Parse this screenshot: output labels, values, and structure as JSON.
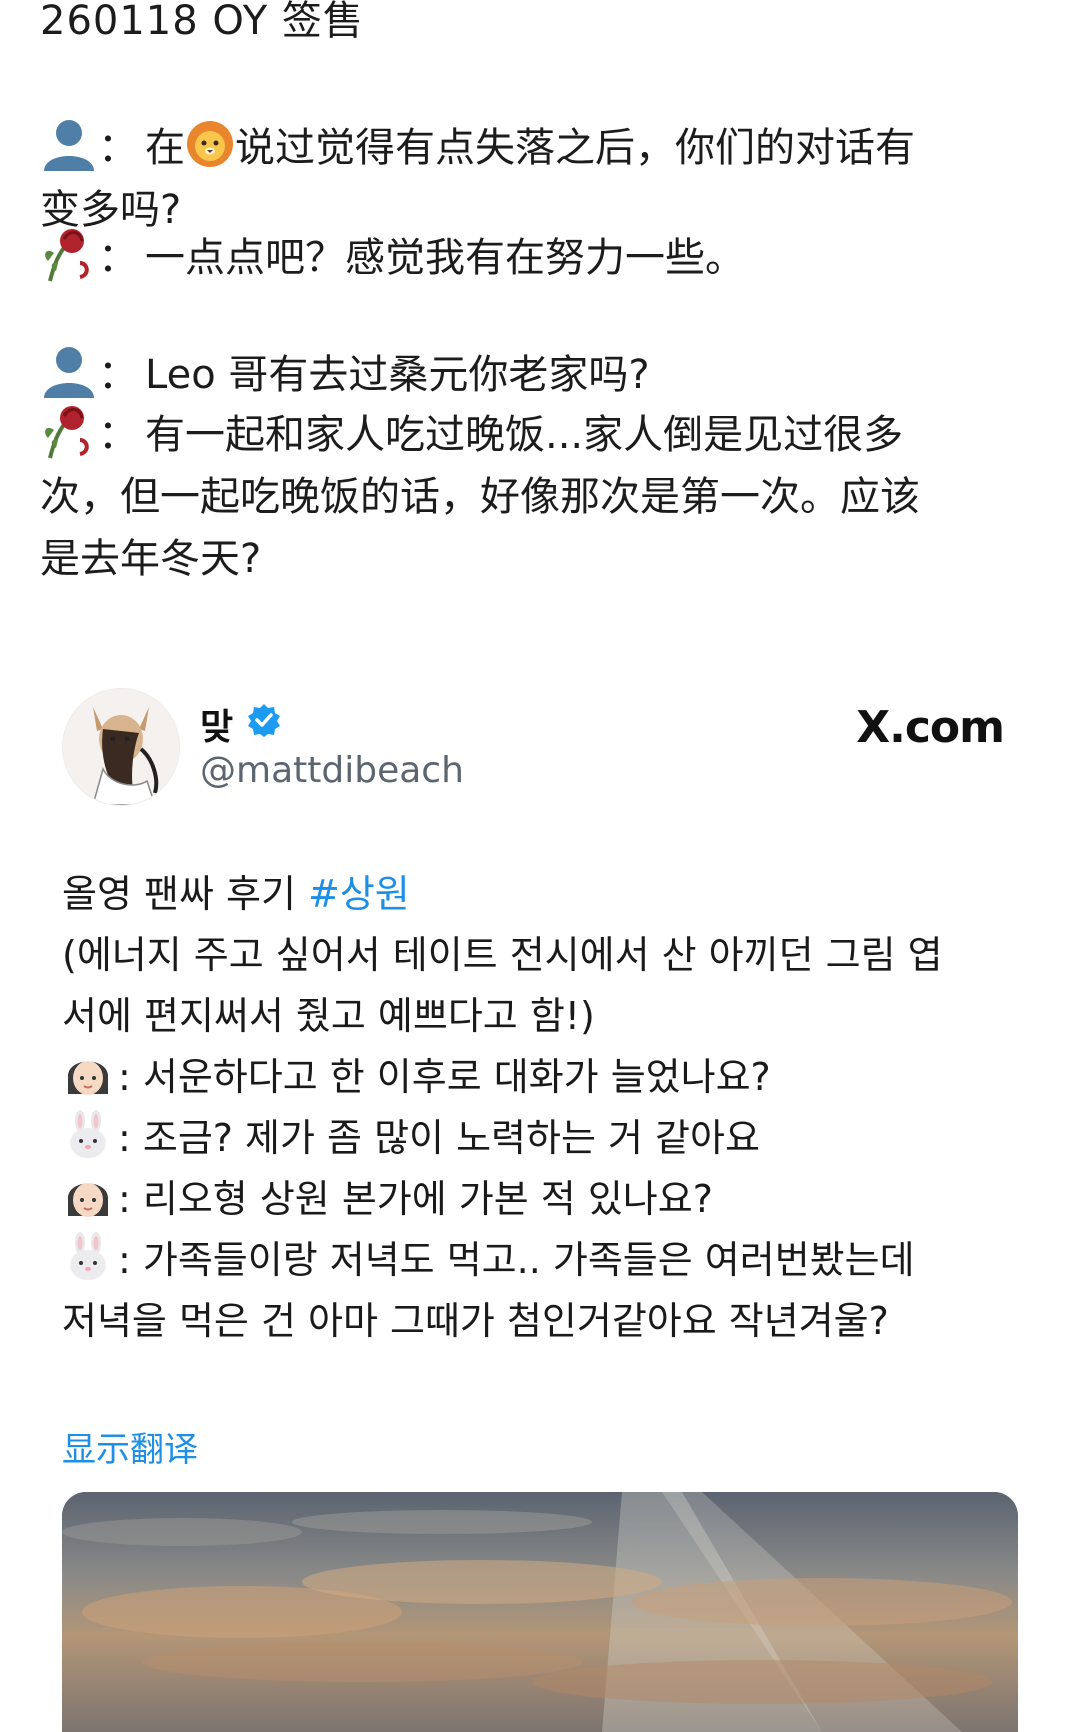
{
  "caption": {
    "header": "260118 OY 签售",
    "dialogue": [
      {
        "speaker": "person-icon",
        "colon": "：",
        "prefix": "在",
        "inline_icon": "lion-emoji",
        "text": "说过觉得有点失落之后，你们的对话有",
        "text2": "变多吗?"
      },
      {
        "speaker": "wilted-rose-icon",
        "colon": "：",
        "text": "一点点吧？感觉我有在努力一些。"
      },
      {
        "speaker": "person-icon",
        "colon": "：",
        "text": "Leo 哥有去过桑元你老家吗?"
      },
      {
        "speaker": "wilted-rose-icon",
        "colon": "：",
        "text": "有一起和家人吃过晚饭...家人倒是见过很多",
        "text2": "次，但一起吃晚饭的话，好像那次是第一次。应该",
        "text3": "是去年冬天?"
      }
    ]
  },
  "tweet": {
    "author": "맞",
    "handle": "@mattdibeach",
    "source": "X.com",
    "colors": {
      "link": "#1d8fe6",
      "verified": "#1d9bf0"
    },
    "body": {
      "line1_text": "올영 팬싸 후기 ",
      "line1_hashtag": "#상원",
      "line2": "(에너지 주고 싶어서 테이트 전시에서 산 아끼던 그림 엽",
      "line3": "서에 편지써서 줬고 예쁘다고 함!)",
      "q1": ": 서운하다고 한 이후로 대화가 늘었나요?",
      "a1": ": 조금? 제가 좀 많이 노력하는 거 같아요",
      "q2": ": 리오형 상원 본가에 가본 적 있나요?",
      "a2": ": 가족들이랑 저녁도 먹고.. 가족들은 여러번봤는데",
      "a2b": "저녁을 먹은 건 아마 그때가 첨인거같아요 작년겨울?"
    },
    "translate_label": "显示翻译"
  }
}
